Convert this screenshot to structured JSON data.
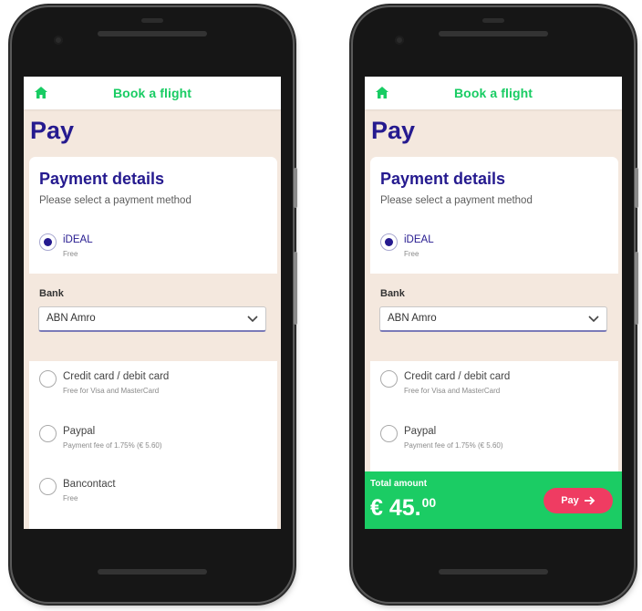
{
  "colors": {
    "accent_green": "#1bcc64",
    "brand_purple": "#251a8f",
    "pay_button": "#ef3c62",
    "background_beige": "#f4e8de"
  },
  "left_phone": {
    "topbar": {
      "title": "Book a flight",
      "home_icon": "home-icon"
    },
    "page_title": "Pay",
    "card": {
      "title": "Payment details",
      "subtitle": "Please select a payment method",
      "options": [
        {
          "label": "iDEAL",
          "sub": "Free",
          "selected": true
        },
        {
          "label": "Credit card / debit card",
          "sub": "Free for Visa and MasterCard",
          "selected": false
        },
        {
          "label": "Paypal",
          "sub": "Payment fee of 1.75% (€ 5.60)",
          "selected": false
        },
        {
          "label": "Bancontact",
          "sub": "Free",
          "selected": false
        }
      ],
      "bank": {
        "label": "Bank",
        "selected": "ABN Amro"
      }
    }
  },
  "right_phone": {
    "topbar": {
      "title": "Book a flight",
      "home_icon": "home-icon"
    },
    "page_title": "Pay",
    "card": {
      "title": "Payment details",
      "subtitle": "Please select a payment method",
      "options": [
        {
          "label": "iDEAL",
          "sub": "Free",
          "selected": true
        },
        {
          "label": "Credit card / debit card",
          "sub": "Free for Visa and MasterCard",
          "selected": false
        },
        {
          "label": "Paypal",
          "sub": "Payment fee of 1.75% (€ 5.60)",
          "selected": false
        }
      ],
      "bank": {
        "label": "Bank",
        "selected": "ABN Amro"
      }
    },
    "total": {
      "label": "Total amount",
      "amount_main": "€ 45.",
      "amount_cents": "00",
      "pay_label": "Pay"
    }
  }
}
